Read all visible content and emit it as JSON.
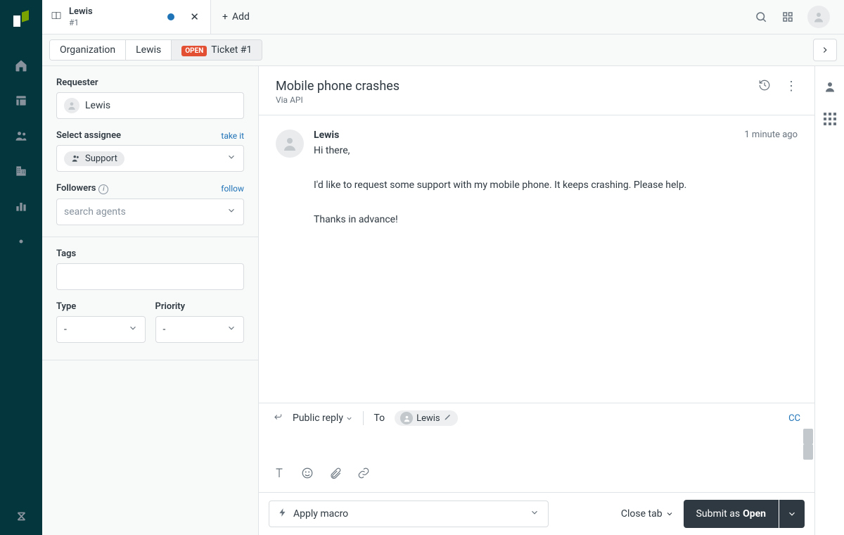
{
  "tab": {
    "title": "Lewis",
    "sub": "#1",
    "add_label": "Add"
  },
  "crumbs": {
    "org": "Organization",
    "user": "Lewis",
    "ticket_status": "OPEN",
    "ticket_label": "Ticket #1"
  },
  "left": {
    "requester_label": "Requester",
    "requester_name": "Lewis",
    "assignee_label": "Select assignee",
    "take_it": "take it",
    "assignee_value": "Support",
    "followers_label": "Followers",
    "follow": "follow",
    "followers_placeholder": "search agents",
    "tags_label": "Tags",
    "type_label": "Type",
    "type_value": "-",
    "priority_label": "Priority",
    "priority_value": "-"
  },
  "ticket": {
    "title": "Mobile phone crashes",
    "via": "Via API"
  },
  "message": {
    "author": "Lewis",
    "time": "1 minute ago",
    "p1": "Hi there,",
    "p2": "I'd like to request some support with my mobile phone. It keeps crashing. Please help.",
    "p3": "Thanks in advance!"
  },
  "reply": {
    "type": "Public reply",
    "to_label": "To",
    "to_name": "Lewis",
    "cc": "CC"
  },
  "footer": {
    "macro": "Apply macro",
    "close_tab": "Close tab",
    "submit_prefix": "Submit as ",
    "submit_status": "Open"
  }
}
